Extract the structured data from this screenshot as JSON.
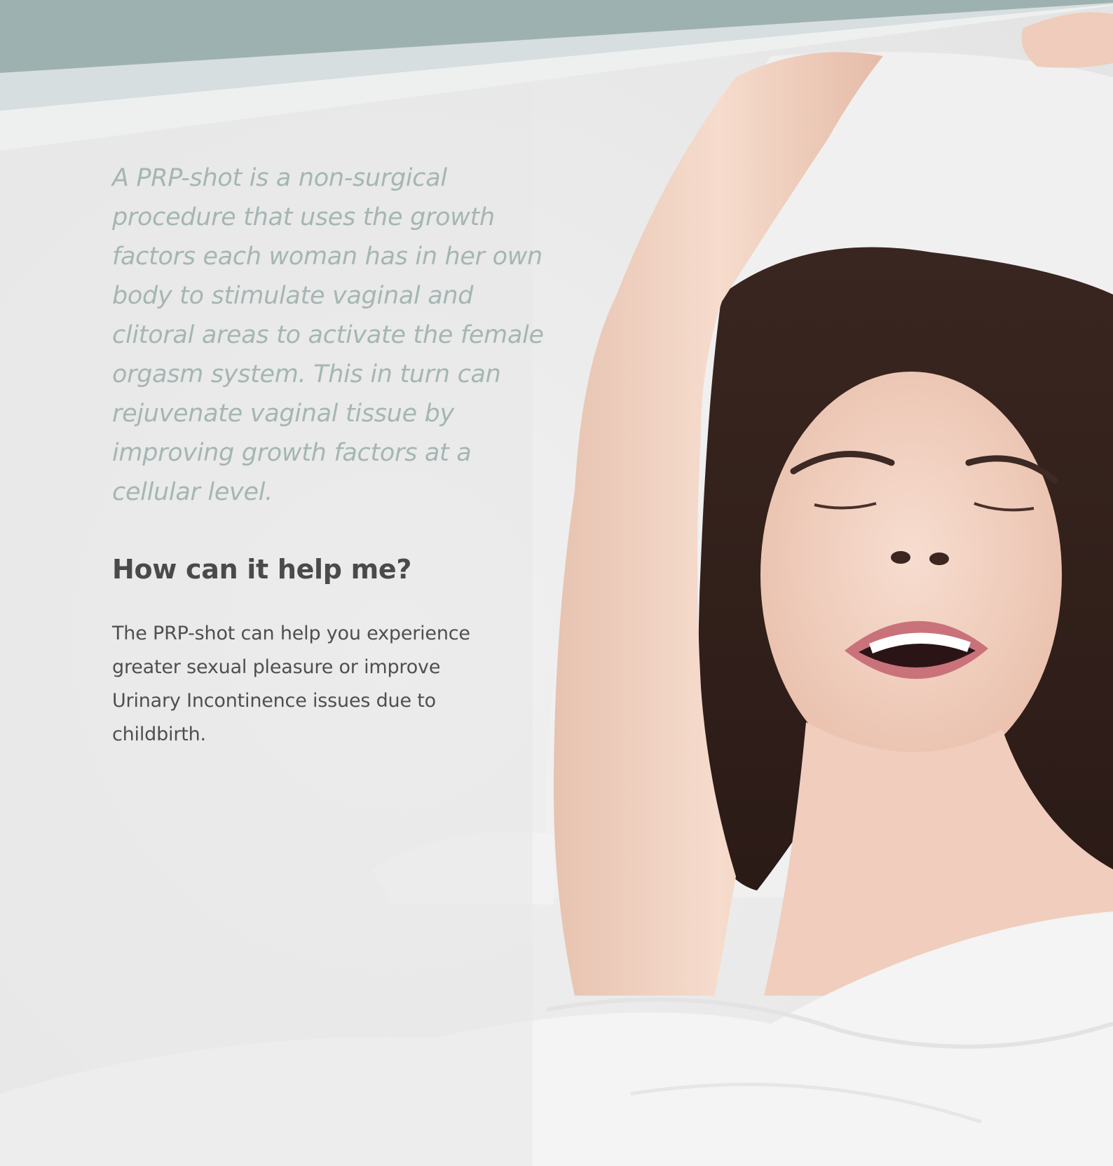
{
  "colors": {
    "header_band": "#9db2b0",
    "header_stripe_light": "#d7dedf",
    "header_stripe_lighter": "#eef0f0",
    "intro_text": "#a5b6b3",
    "heading_text": "#4a4a4a",
    "body_text": "#4f4f4f"
  },
  "intro": {
    "text": "A PRP-shot is a non-surgical procedure that uses the growth factors each woman has in her own body to stimulate vaginal and clitoral areas to activate the female orgasm system. This in turn can rejuvenate vaginal tissue by improving growth factors at a cellular level."
  },
  "section": {
    "heading": "How can it help me?",
    "body": "The PRP-shot can help you experience greater sexual pleasure or improve Urinary Incontinence issues due to childbirth."
  }
}
